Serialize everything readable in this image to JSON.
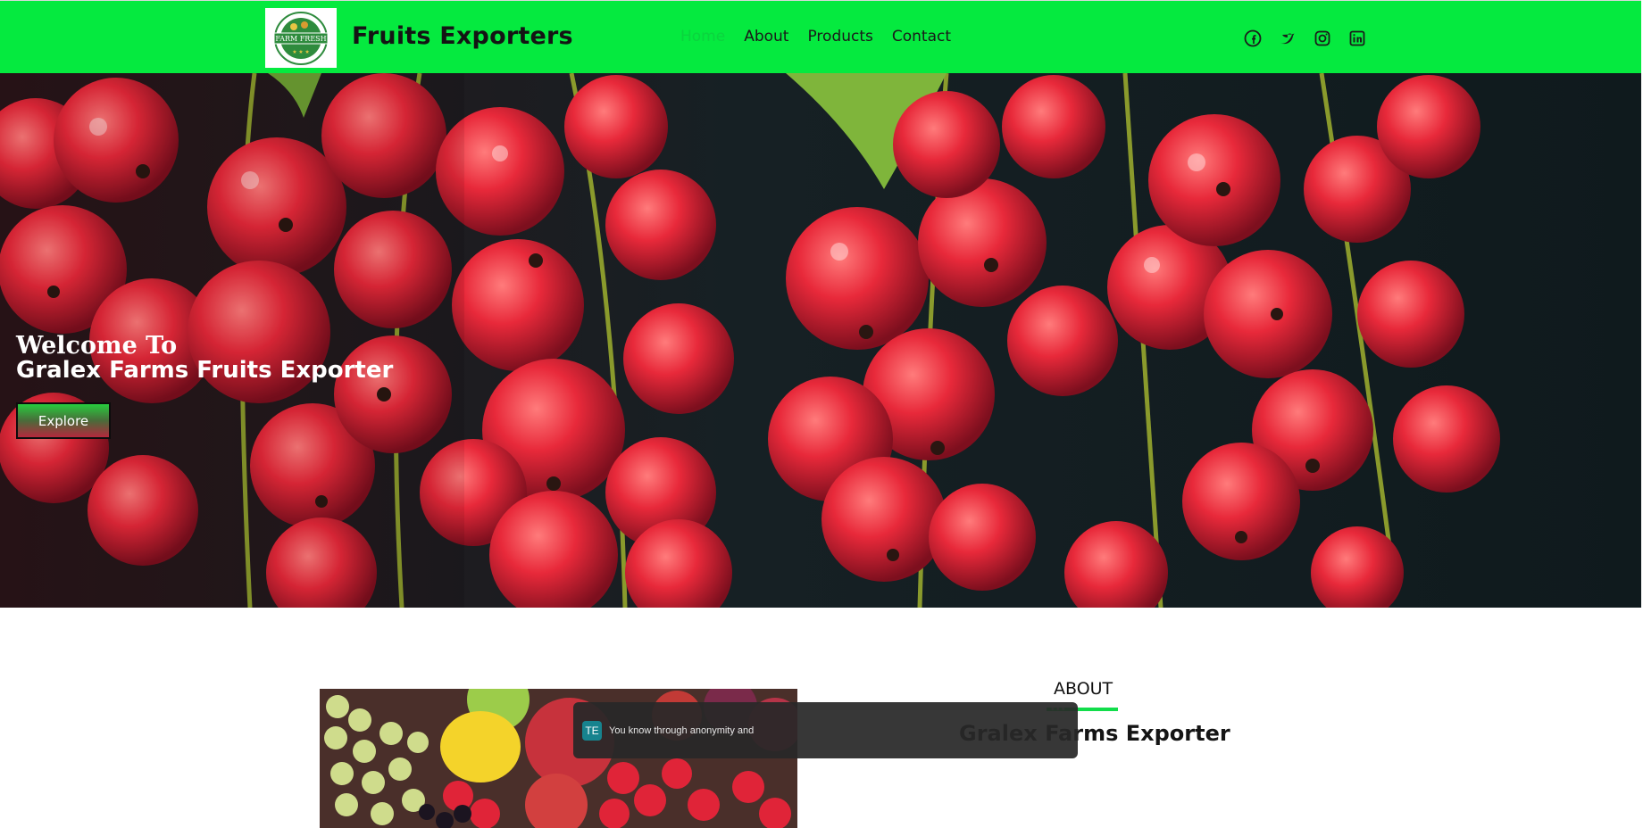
{
  "header": {
    "brand": "Fruits Exporters",
    "logo_text": "FARM FRESH",
    "nav": [
      {
        "label": "Home",
        "active": true
      },
      {
        "label": "About",
        "active": false
      },
      {
        "label": "Products",
        "active": false
      },
      {
        "label": "Contact",
        "active": false
      }
    ],
    "social_icons": [
      "facebook-icon",
      "twitter-icon",
      "instagram-icon",
      "linkedin-icon"
    ]
  },
  "hero": {
    "welcome": "Welcome To",
    "title": "Gralex Farms Fruits Exporter",
    "button_label": "Explore"
  },
  "about": {
    "heading": "ABOUT",
    "dots": "•••",
    "title": "Gralex Farms Exporter"
  },
  "toast": {
    "avatar": "TE",
    "text": "You know through anonymity and"
  },
  "colors": {
    "header_bg": "#05ea3f",
    "accent": "#12dd4b",
    "hero_bg": "#121c1f",
    "berry": "#e8293a"
  }
}
